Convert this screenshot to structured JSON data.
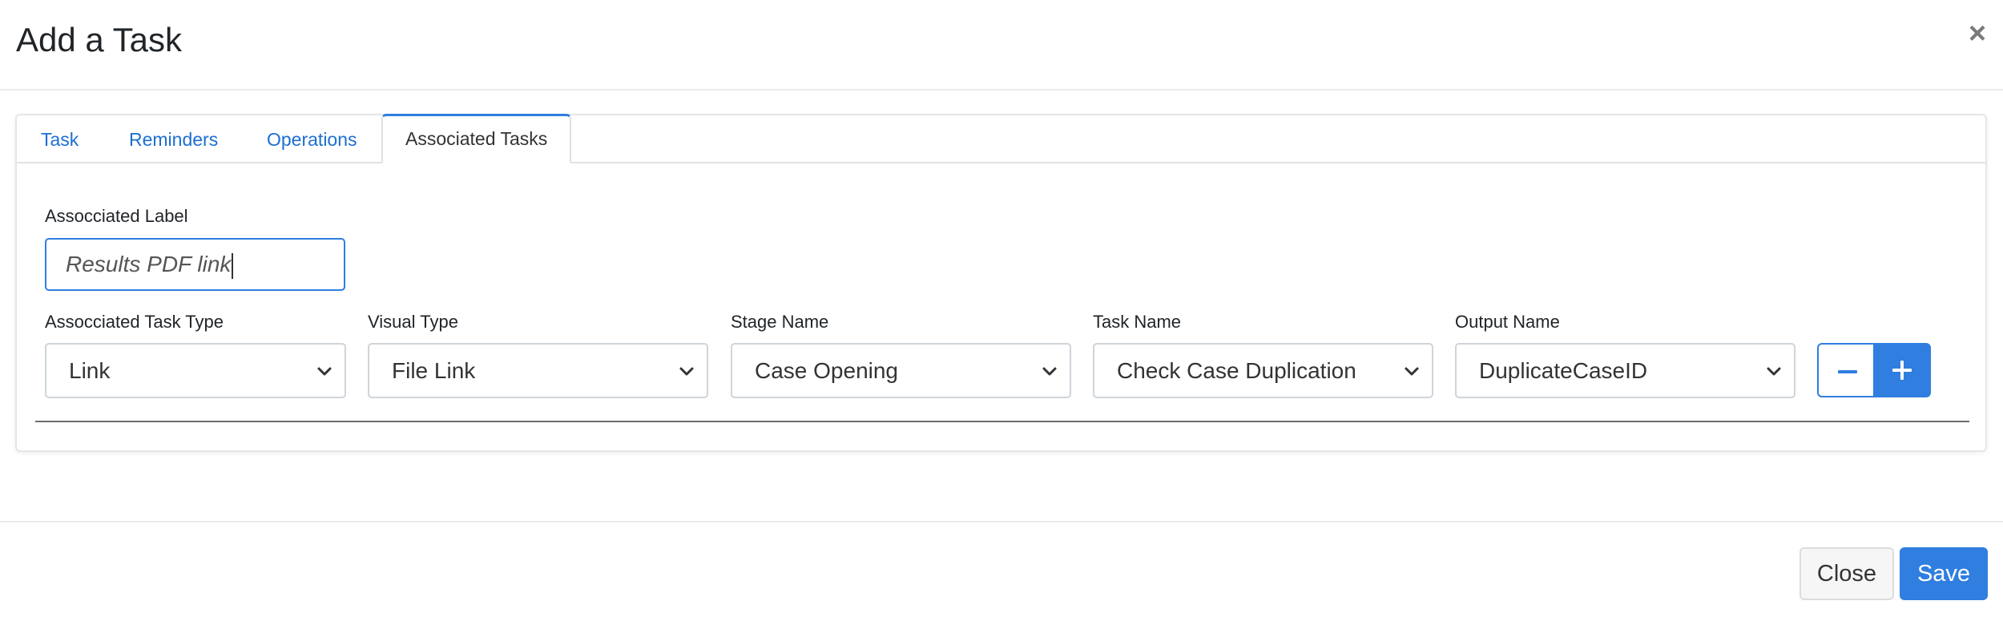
{
  "modal": {
    "title": "Add a Task",
    "close_icon": "close-icon"
  },
  "tabs": [
    {
      "label": "Task",
      "active": false
    },
    {
      "label": "Reminders",
      "active": false
    },
    {
      "label": "Operations",
      "active": false
    },
    {
      "label": "Associated Tasks",
      "active": true
    }
  ],
  "form": {
    "associated_label": {
      "label": "Assocciated Label",
      "value": "Results PDF link"
    },
    "fields": [
      {
        "label": "Assocciated Task Type",
        "value": "Link"
      },
      {
        "label": "Visual Type",
        "value": "File Link"
      },
      {
        "label": "Stage Name",
        "value": "Case Opening"
      },
      {
        "label": "Task Name",
        "value": "Check Case Duplication"
      },
      {
        "label": "Output Name",
        "value": "DuplicateCaseID"
      }
    ],
    "remove_icon": "minus-icon",
    "add_icon": "plus-icon"
  },
  "footer": {
    "close_label": "Close",
    "save_label": "Save"
  },
  "colors": {
    "accent": "#2f7ee0",
    "link": "#1c6fd1"
  }
}
